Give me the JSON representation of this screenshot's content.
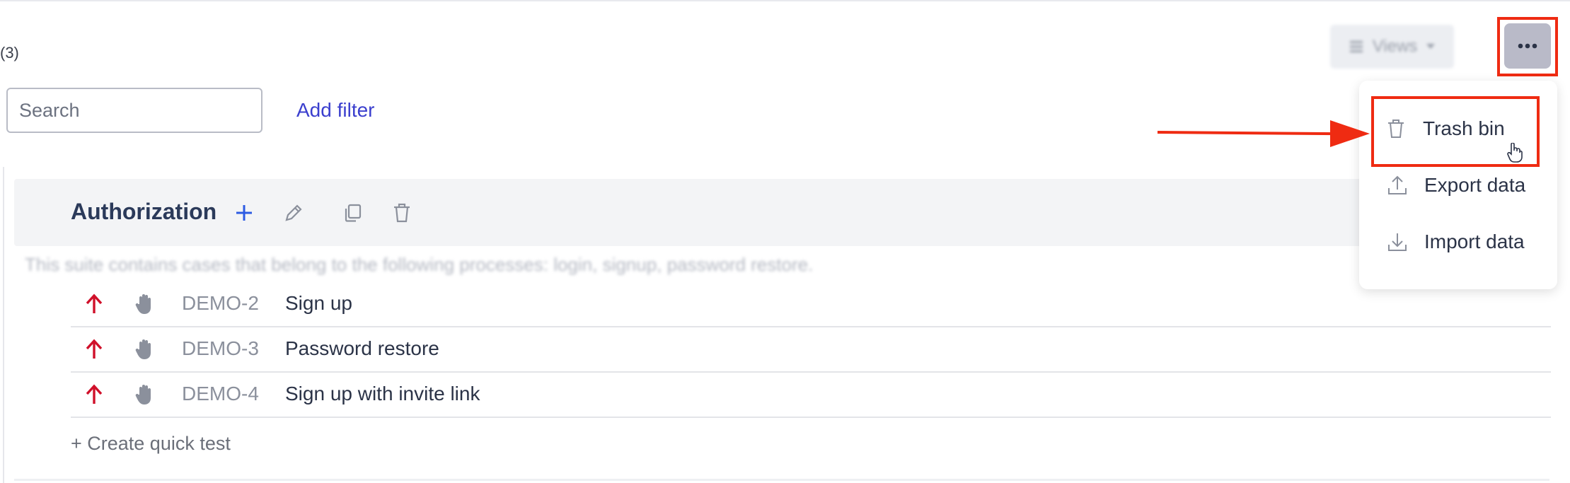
{
  "header": {
    "count_text": "(3)",
    "views_label": "Views",
    "more_label": "..."
  },
  "filters": {
    "search_placeholder": "Search",
    "search_value": "",
    "add_filter_label": "Add filter"
  },
  "suite": {
    "title": "Authorization",
    "description": "This suite contains cases that belong to the following processes: login, signup, password restore.",
    "cases": [
      {
        "id": "DEMO-2",
        "name": "Sign up",
        "priority_icon": "arrow-up-icon",
        "type_icon": "hand-icon"
      },
      {
        "id": "DEMO-3",
        "name": "Password restore",
        "priority_icon": "arrow-up-icon",
        "type_icon": "hand-icon"
      },
      {
        "id": "DEMO-4",
        "name": "Sign up with invite link",
        "priority_icon": "arrow-up-icon",
        "type_icon": "hand-icon"
      }
    ],
    "quick_test_label": "+ Create quick test"
  },
  "menu": {
    "items": [
      {
        "label": "Trash bin",
        "icon": "trash-icon"
      },
      {
        "label": "Export data",
        "icon": "export-icon"
      },
      {
        "label": "Import data",
        "icon": "import-icon"
      }
    ]
  },
  "colors": {
    "accent_link": "#3b3fce",
    "highlight": "#ef2b12",
    "priority_high": "#d0102a",
    "plus_icon": "#2d5be3"
  }
}
